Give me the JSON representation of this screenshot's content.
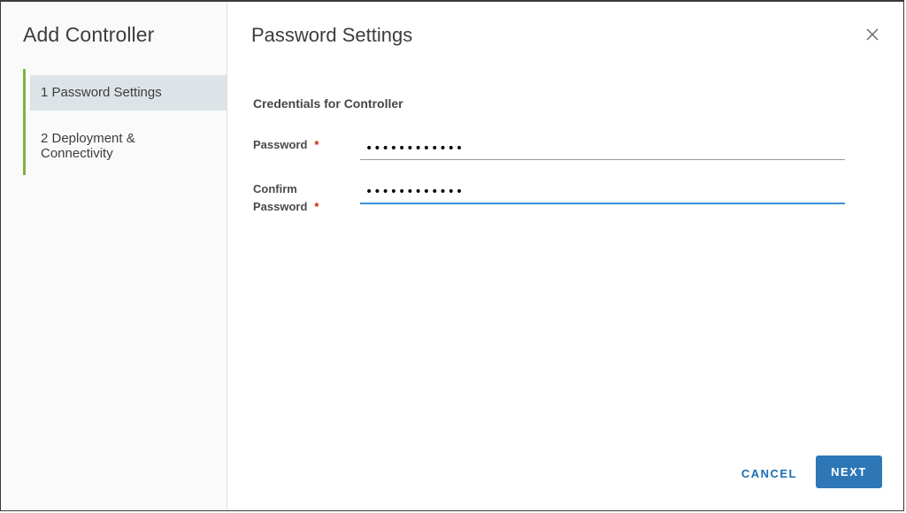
{
  "wizard": {
    "title": "Add Controller",
    "steps": [
      {
        "label": "1 Password Settings",
        "active": true
      },
      {
        "label_line1": "2  Deployment &",
        "label_line2": "Connectivity",
        "active": false
      }
    ],
    "step_indicator_color": "#7cb342"
  },
  "page": {
    "title": "Password Settings",
    "section_title": "Credentials for Controller"
  },
  "form": {
    "password": {
      "label": "Password",
      "required_marker": "*",
      "value": "••••••••••••"
    },
    "confirm_password": {
      "label_line1": "Confirm",
      "label_line2": "Password",
      "required_marker": "*",
      "value": "••••••••••••"
    }
  },
  "footer": {
    "cancel_label": "CANCEL",
    "next_label": "NEXT"
  },
  "icons": {
    "close": "close-icon"
  },
  "colors": {
    "accent": "#2d77b7",
    "required": "#c92100",
    "focus": "#3b8fd6"
  }
}
